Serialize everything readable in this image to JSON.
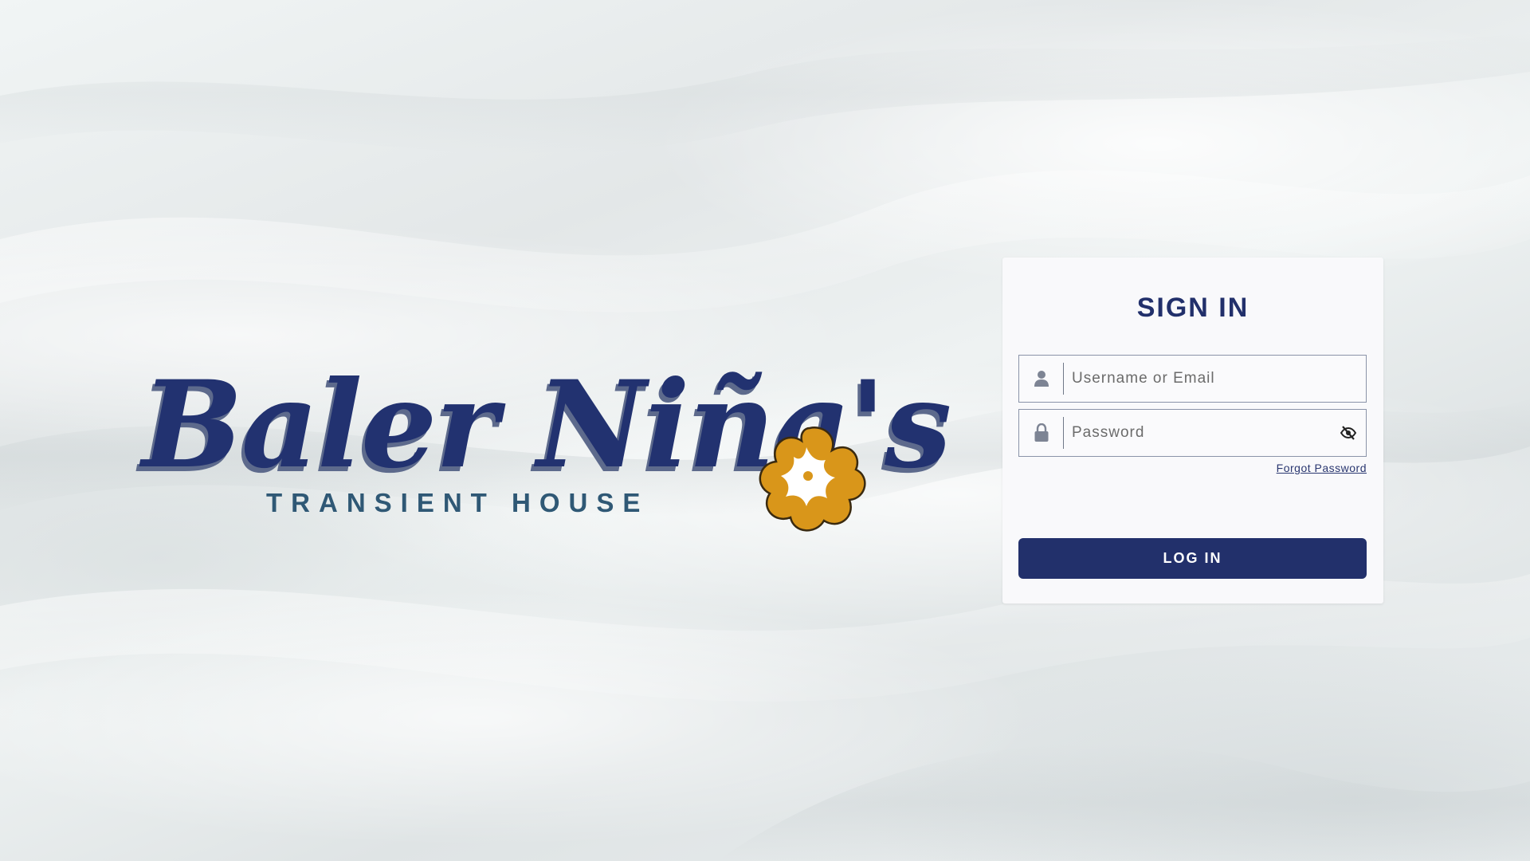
{
  "logo": {
    "script_text": "Baler Niña's",
    "subtitle": "TRANSIENT HOUSE",
    "flower_color": "#d9961a",
    "text_color": "#223270"
  },
  "login": {
    "title": "SIGN IN",
    "username_placeholder": "Username or Email",
    "username_value": "",
    "password_placeholder": "Password",
    "password_value": "",
    "forgot_label": "Forgot Password",
    "submit_label": "LOG IN",
    "accent_color": "#22306b",
    "icons": {
      "username": "user-icon",
      "password": "lock-icon",
      "toggle": "eye-slash-icon"
    }
  }
}
